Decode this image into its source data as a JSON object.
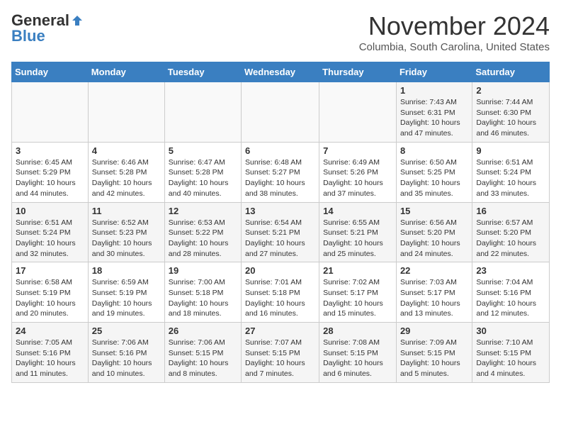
{
  "header": {
    "logo_line1": "General",
    "logo_line2": "Blue",
    "month": "November 2024",
    "location": "Columbia, South Carolina, United States"
  },
  "weekdays": [
    "Sunday",
    "Monday",
    "Tuesday",
    "Wednesday",
    "Thursday",
    "Friday",
    "Saturday"
  ],
  "weeks": [
    [
      {
        "day": "",
        "info": ""
      },
      {
        "day": "",
        "info": ""
      },
      {
        "day": "",
        "info": ""
      },
      {
        "day": "",
        "info": ""
      },
      {
        "day": "",
        "info": ""
      },
      {
        "day": "1",
        "info": "Sunrise: 7:43 AM\nSunset: 6:31 PM\nDaylight: 10 hours and 47 minutes."
      },
      {
        "day": "2",
        "info": "Sunrise: 7:44 AM\nSunset: 6:30 PM\nDaylight: 10 hours and 46 minutes."
      }
    ],
    [
      {
        "day": "3",
        "info": "Sunrise: 6:45 AM\nSunset: 5:29 PM\nDaylight: 10 hours and 44 minutes."
      },
      {
        "day": "4",
        "info": "Sunrise: 6:46 AM\nSunset: 5:28 PM\nDaylight: 10 hours and 42 minutes."
      },
      {
        "day": "5",
        "info": "Sunrise: 6:47 AM\nSunset: 5:28 PM\nDaylight: 10 hours and 40 minutes."
      },
      {
        "day": "6",
        "info": "Sunrise: 6:48 AM\nSunset: 5:27 PM\nDaylight: 10 hours and 38 minutes."
      },
      {
        "day": "7",
        "info": "Sunrise: 6:49 AM\nSunset: 5:26 PM\nDaylight: 10 hours and 37 minutes."
      },
      {
        "day": "8",
        "info": "Sunrise: 6:50 AM\nSunset: 5:25 PM\nDaylight: 10 hours and 35 minutes."
      },
      {
        "day": "9",
        "info": "Sunrise: 6:51 AM\nSunset: 5:24 PM\nDaylight: 10 hours and 33 minutes."
      }
    ],
    [
      {
        "day": "10",
        "info": "Sunrise: 6:51 AM\nSunset: 5:24 PM\nDaylight: 10 hours and 32 minutes."
      },
      {
        "day": "11",
        "info": "Sunrise: 6:52 AM\nSunset: 5:23 PM\nDaylight: 10 hours and 30 minutes."
      },
      {
        "day": "12",
        "info": "Sunrise: 6:53 AM\nSunset: 5:22 PM\nDaylight: 10 hours and 28 minutes."
      },
      {
        "day": "13",
        "info": "Sunrise: 6:54 AM\nSunset: 5:21 PM\nDaylight: 10 hours and 27 minutes."
      },
      {
        "day": "14",
        "info": "Sunrise: 6:55 AM\nSunset: 5:21 PM\nDaylight: 10 hours and 25 minutes."
      },
      {
        "day": "15",
        "info": "Sunrise: 6:56 AM\nSunset: 5:20 PM\nDaylight: 10 hours and 24 minutes."
      },
      {
        "day": "16",
        "info": "Sunrise: 6:57 AM\nSunset: 5:20 PM\nDaylight: 10 hours and 22 minutes."
      }
    ],
    [
      {
        "day": "17",
        "info": "Sunrise: 6:58 AM\nSunset: 5:19 PM\nDaylight: 10 hours and 20 minutes."
      },
      {
        "day": "18",
        "info": "Sunrise: 6:59 AM\nSunset: 5:19 PM\nDaylight: 10 hours and 19 minutes."
      },
      {
        "day": "19",
        "info": "Sunrise: 7:00 AM\nSunset: 5:18 PM\nDaylight: 10 hours and 18 minutes."
      },
      {
        "day": "20",
        "info": "Sunrise: 7:01 AM\nSunset: 5:18 PM\nDaylight: 10 hours and 16 minutes."
      },
      {
        "day": "21",
        "info": "Sunrise: 7:02 AM\nSunset: 5:17 PM\nDaylight: 10 hours and 15 minutes."
      },
      {
        "day": "22",
        "info": "Sunrise: 7:03 AM\nSunset: 5:17 PM\nDaylight: 10 hours and 13 minutes."
      },
      {
        "day": "23",
        "info": "Sunrise: 7:04 AM\nSunset: 5:16 PM\nDaylight: 10 hours and 12 minutes."
      }
    ],
    [
      {
        "day": "24",
        "info": "Sunrise: 7:05 AM\nSunset: 5:16 PM\nDaylight: 10 hours and 11 minutes."
      },
      {
        "day": "25",
        "info": "Sunrise: 7:06 AM\nSunset: 5:16 PM\nDaylight: 10 hours and 10 minutes."
      },
      {
        "day": "26",
        "info": "Sunrise: 7:06 AM\nSunset: 5:15 PM\nDaylight: 10 hours and 8 minutes."
      },
      {
        "day": "27",
        "info": "Sunrise: 7:07 AM\nSunset: 5:15 PM\nDaylight: 10 hours and 7 minutes."
      },
      {
        "day": "28",
        "info": "Sunrise: 7:08 AM\nSunset: 5:15 PM\nDaylight: 10 hours and 6 minutes."
      },
      {
        "day": "29",
        "info": "Sunrise: 7:09 AM\nSunset: 5:15 PM\nDaylight: 10 hours and 5 minutes."
      },
      {
        "day": "30",
        "info": "Sunrise: 7:10 AM\nSunset: 5:15 PM\nDaylight: 10 hours and 4 minutes."
      }
    ]
  ]
}
